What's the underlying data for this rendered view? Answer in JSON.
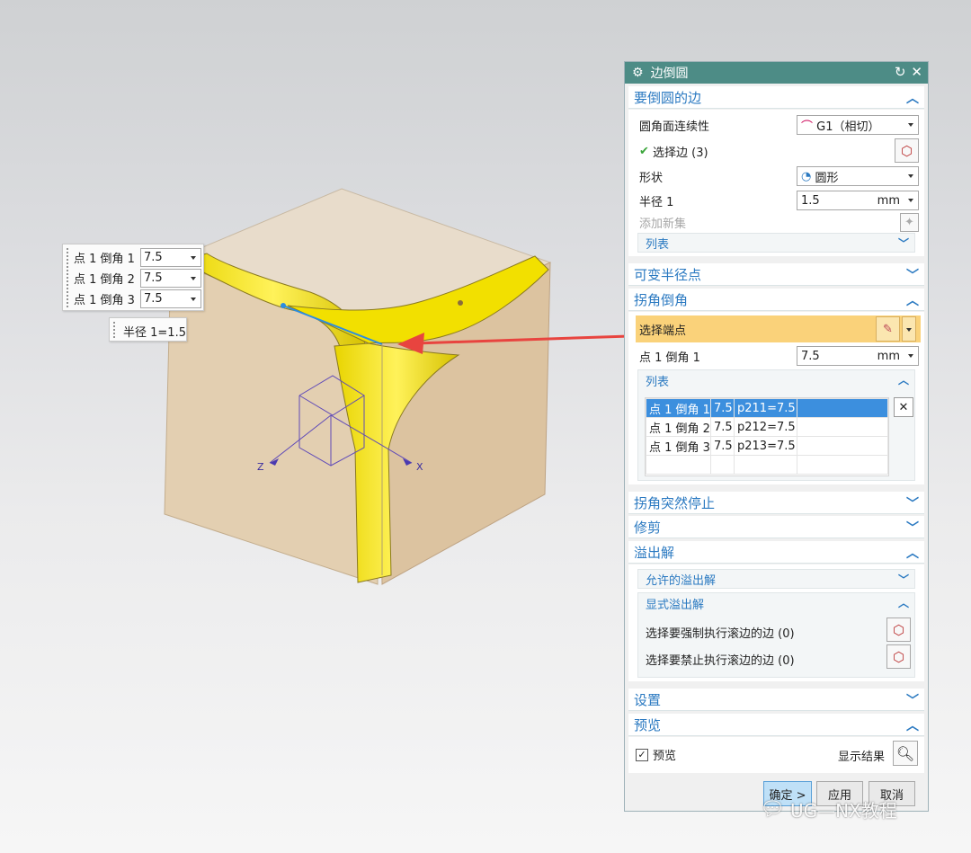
{
  "dialog": {
    "title": "边倒圆",
    "sections": {
      "edges": {
        "title": "要倒圆的边",
        "continuity_label": "圆角面连续性",
        "continuity_value": "G1（相切）",
        "select_edge_label": "选择边 (3)",
        "shape_label": "形状",
        "shape_value": "圆形",
        "radius_label": "半径 1",
        "radius_value": "1.5",
        "radius_unit": "mm",
        "add_set_label": "添加新集",
        "list_label": "列表"
      },
      "variable_radius": {
        "title": "可变半径点"
      },
      "corner": {
        "title": "拐角倒角",
        "select_endpoint_label": "选择端点",
        "point_label": "点 1 倒角 1",
        "point_value": "7.5",
        "point_unit": "mm",
        "list_label": "列表",
        "rows": [
          {
            "name": "点 1 倒角 1",
            "value": "7.5",
            "expr": "p211=7.5"
          },
          {
            "name": "点 1 倒角 2",
            "value": "7.5",
            "expr": "p212=7.5"
          },
          {
            "name": "点 1 倒角 3",
            "value": "7.5",
            "expr": "p213=7.5"
          }
        ]
      },
      "corner_stop": {
        "title": "拐角突然停止"
      },
      "trim": {
        "title": "修剪"
      },
      "overflow": {
        "title": "溢出解",
        "allowed_label": "允许的溢出解",
        "explicit_label": "显式溢出解",
        "force_roll_label": "选择要强制执行滚边的边 (0)",
        "forbid_roll_label": "选择要禁止执行滚边的边 (0)"
      },
      "settings": {
        "title": "设置"
      },
      "preview": {
        "title": "预览",
        "checkbox_label": "预览",
        "checked": true,
        "show_result_label": "显示结果"
      }
    },
    "buttons": {
      "ok": "确定 >",
      "apply": "应用",
      "cancel": "取消"
    }
  },
  "floating": {
    "rows": [
      {
        "label": "点 1 倒角 1",
        "value": "7.5"
      },
      {
        "label": "点 1 倒角 2",
        "value": "7.5"
      },
      {
        "label": "点 1 倒角 3",
        "value": "7.5"
      }
    ],
    "radius_tag": "半径 1=1.5"
  },
  "axes": {
    "z": "Z",
    "x": "X"
  },
  "watermark": "UG—NX教程",
  "colors": {
    "title_bar": "#4d8c86",
    "section_text": "#2a79c1",
    "highlight_row": "#fad27a",
    "blend_face": "#f5e500",
    "selected_row": "#3c8fde",
    "arrow": "#e8443f"
  }
}
